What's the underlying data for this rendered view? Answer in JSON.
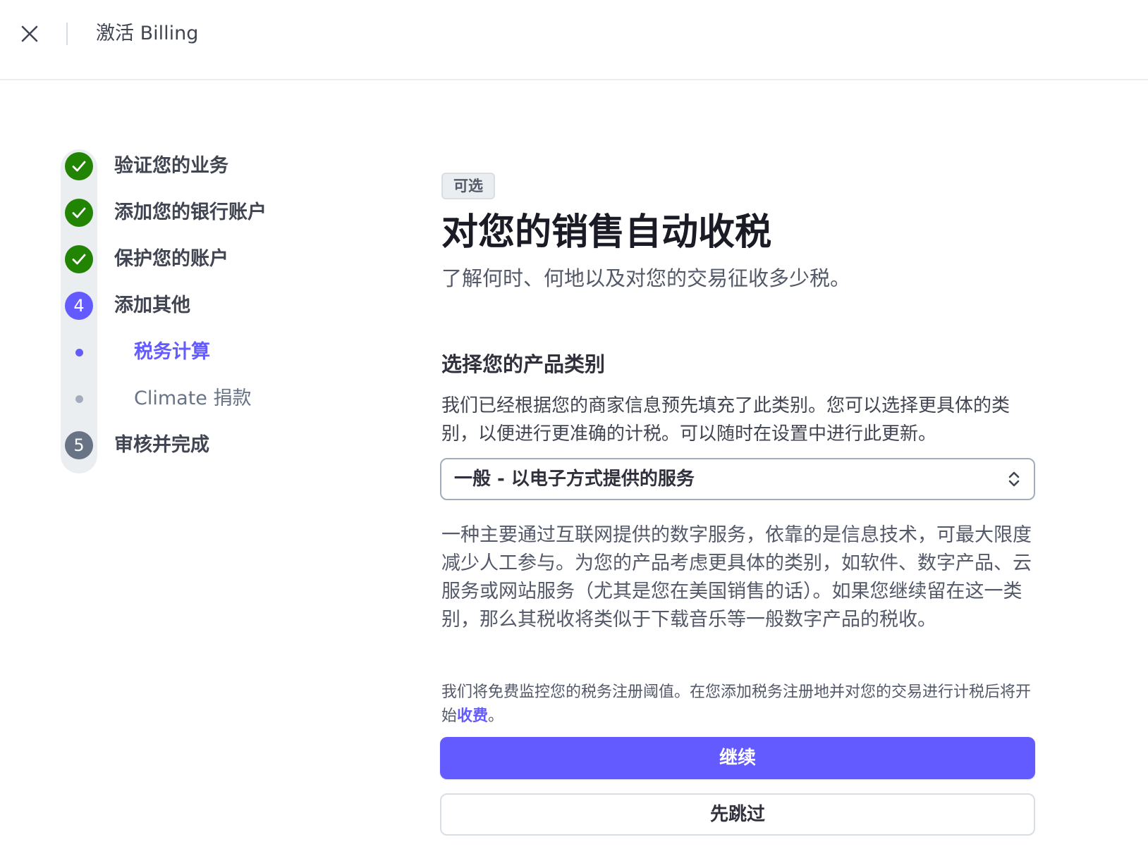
{
  "header": {
    "title": "激活 Billing",
    "close_icon": "close-icon"
  },
  "stepper": {
    "steps": [
      {
        "label": "验证您的业务",
        "status": "done",
        "icon": "check-icon"
      },
      {
        "label": "添加您的银行账户",
        "status": "done",
        "icon": "check-icon"
      },
      {
        "label": "保护您的账户",
        "status": "done",
        "icon": "check-icon"
      },
      {
        "label": "添加其他",
        "status": "active",
        "number": "4"
      },
      {
        "label": "审核并完成",
        "status": "todo",
        "number": "5"
      }
    ],
    "substeps": [
      {
        "label": "税务计算",
        "status": "active"
      },
      {
        "label": "Climate 捐款",
        "status": "todo"
      }
    ]
  },
  "main": {
    "badge": "可选",
    "title": "对您的销售自动收税",
    "subtitle": "了解何时、何地以及对您的交易征收多少税。",
    "section_title": "选择您的产品类别",
    "section_desc": "我们已经根据您的商家信息预先填充了此类别。您可以选择更具体的类别，以便进行更准确的计税。可以随时在设置中进行此更新。",
    "select_value": "一般 - 以电子方式提供的服务",
    "category_desc": "一种主要通过互联网提供的数字服务，依靠的是信息技术，可最大限度减少人工参与。为您的产品考虑更具体的类别，如软件、数字产品、云服务或网站服务（尤其是您在美国销售的话）。如果您继续留在这一类别，那么其税收将类似于下载音乐等一般数字产品的税收。",
    "note_prefix": "我们将免费监控您的税务注册阈值。在您添加税务注册地并对您的交易进行计税后将开始",
    "note_link": "收费",
    "note_suffix": "。",
    "continue_label": "继续",
    "skip_label": "先跳过"
  },
  "colors": {
    "accent": "#635bff",
    "success": "#228403",
    "neutral_step": "#687385"
  }
}
